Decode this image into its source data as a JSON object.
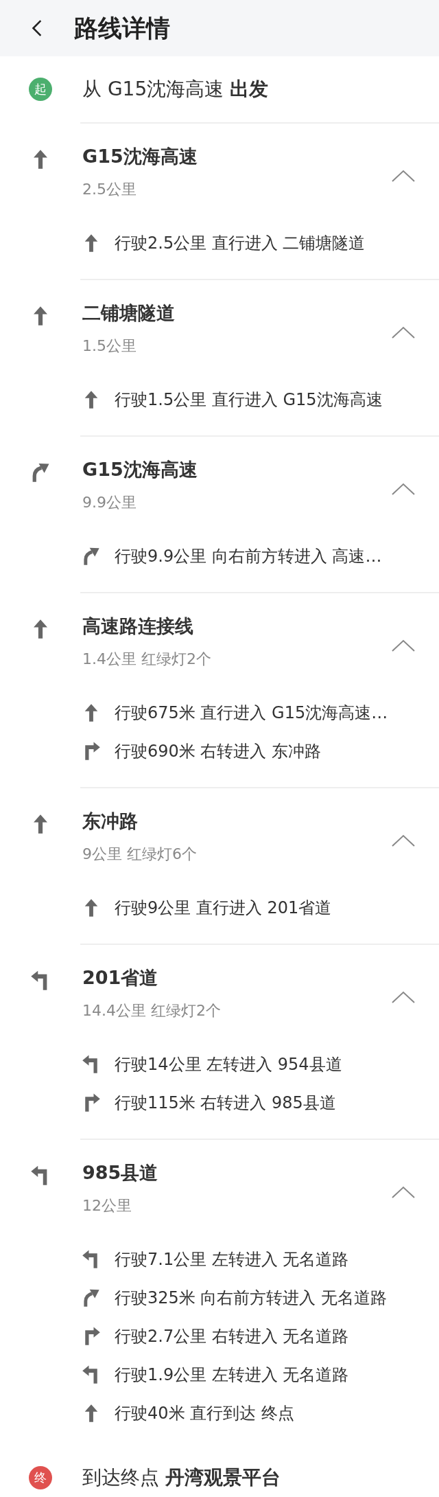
{
  "header": {
    "title": "路线详情"
  },
  "start": {
    "badge": "起",
    "text": "从 G15沈海高速 **出发**"
  },
  "sections": [
    {
      "kind": "straight",
      "title": "G15沈海高速",
      "subtitle": "2.5公里",
      "expanded": true,
      "steps": [
        {
          "kind": "straight",
          "text": "行驶2.5公里 直行进入 二铺塘隧道"
        }
      ]
    },
    {
      "kind": "straight",
      "title": "二铺塘隧道",
      "subtitle": "1.5公里",
      "expanded": true,
      "steps": [
        {
          "kind": "straight",
          "text": "行驶1.5公里 直行进入 G15沈海高速"
        }
      ]
    },
    {
      "kind": "slight_right",
      "title": "G15沈海高速",
      "subtitle": "9.9公里",
      "expanded": true,
      "steps": [
        {
          "kind": "slight_right",
          "text": "行驶9.9公里 向右前方转进入 高速…"
        }
      ]
    },
    {
      "kind": "straight",
      "title": "高速路连接线",
      "subtitle": "1.4公里 红绿灯2个",
      "expanded": true,
      "steps": [
        {
          "kind": "straight",
          "text": "行驶675米 直行进入 G15沈海高速…"
        },
        {
          "kind": "right",
          "text": "行驶690米 右转进入 东冲路"
        }
      ]
    },
    {
      "kind": "straight",
      "title": "东冲路",
      "subtitle": "9公里 红绿灯6个",
      "expanded": true,
      "steps": [
        {
          "kind": "straight",
          "text": "行驶9公里 直行进入 201省道"
        }
      ]
    },
    {
      "kind": "left",
      "title": "201省道",
      "subtitle": "14.4公里 红绿灯2个",
      "expanded": true,
      "steps": [
        {
          "kind": "left",
          "text": "行驶14公里 左转进入 954县道"
        },
        {
          "kind": "right",
          "text": "行驶115米 右转进入 985县道"
        }
      ]
    },
    {
      "kind": "left",
      "title": "985县道",
      "subtitle": "12公里",
      "expanded": true,
      "steps": [
        {
          "kind": "left",
          "text": "行驶7.1公里 左转进入 无名道路"
        },
        {
          "kind": "slight_right",
          "text": "行驶325米 向右前方转进入 无名道路"
        },
        {
          "kind": "right",
          "text": "行驶2.7公里 右转进入 无名道路"
        },
        {
          "kind": "left",
          "text": "行驶1.9公里 左转进入 无名道路"
        },
        {
          "kind": "straight",
          "text": "行驶40米 直行到达 终点"
        }
      ]
    }
  ],
  "end": {
    "badge": "终",
    "text": "到达终点  **丹湾观景平台**"
  }
}
